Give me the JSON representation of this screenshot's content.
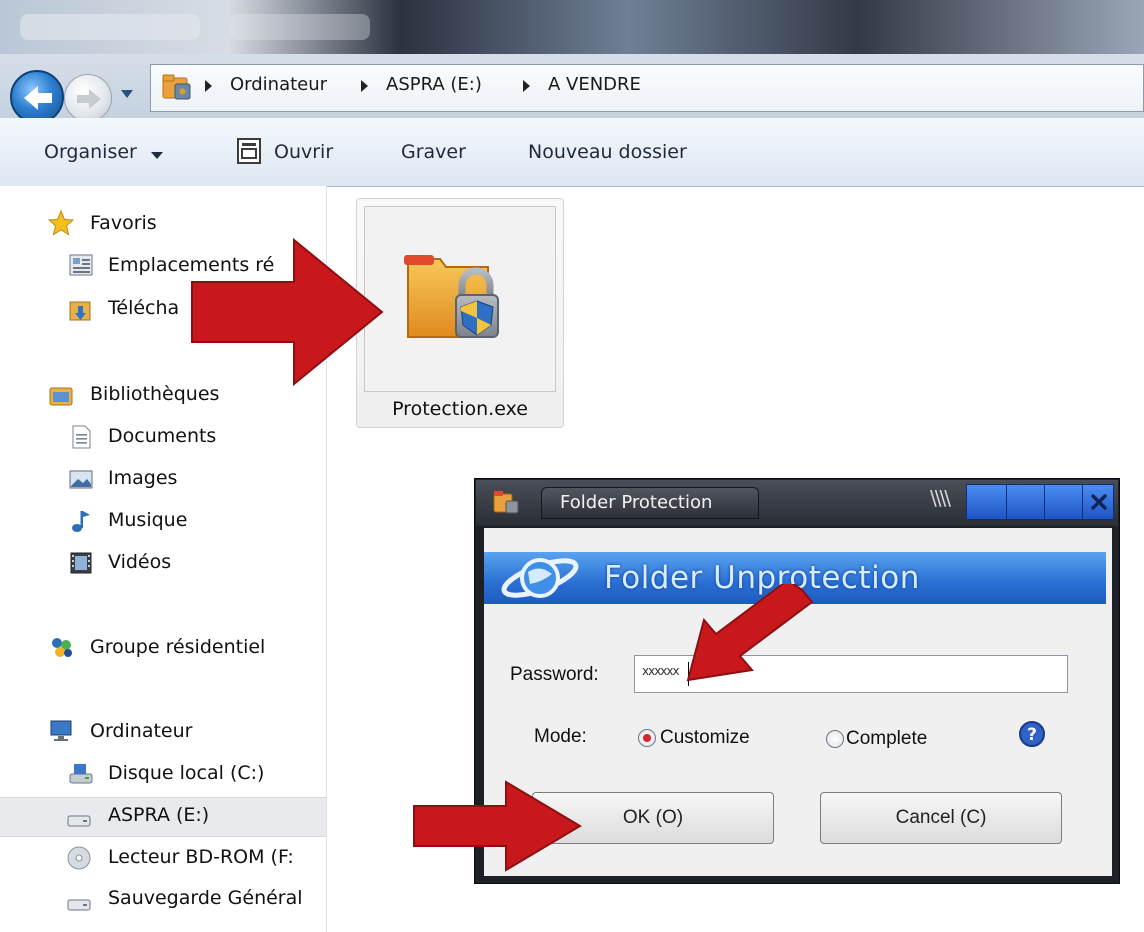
{
  "breadcrumb": {
    "items": [
      "Ordinateur",
      "ASPRA (E:)",
      "A VENDRE"
    ]
  },
  "toolbar": {
    "organize": "Organiser",
    "open": "Ouvrir",
    "burn": "Graver",
    "new_folder": "Nouveau dossier"
  },
  "sidebar": {
    "favorites": {
      "label": "Favoris",
      "items": [
        "Emplacements ré",
        "Télécha"
      ]
    },
    "libraries": {
      "label": "Bibliothèques",
      "items": [
        "Documents",
        "Images",
        "Musique",
        "Vidéos"
      ]
    },
    "homegroup": {
      "label": "Groupe résidentiel"
    },
    "computer": {
      "label": "Ordinateur",
      "items": [
        "Disque local (C:)",
        "ASPRA (E:)",
        "Lecteur BD-ROM (F:",
        "Sauvegarde Général"
      ],
      "selected": "ASPRA (E:)"
    }
  },
  "file": {
    "name": "Protection.exe"
  },
  "dialog": {
    "title": "Folder Protection",
    "banner": "Folder Unprotection",
    "password_label": "Password:",
    "password_value": "xxxxxx",
    "mode_label": "Mode:",
    "mode_options": [
      "Customize",
      "Complete"
    ],
    "mode_selected": "Customize",
    "ok_button": "OK (O)",
    "cancel_button": "Cancel (C)"
  },
  "colors": {
    "arrow": "#c8181c",
    "selection": "#e8eaed",
    "banner_blue": "#2a6fd3"
  }
}
